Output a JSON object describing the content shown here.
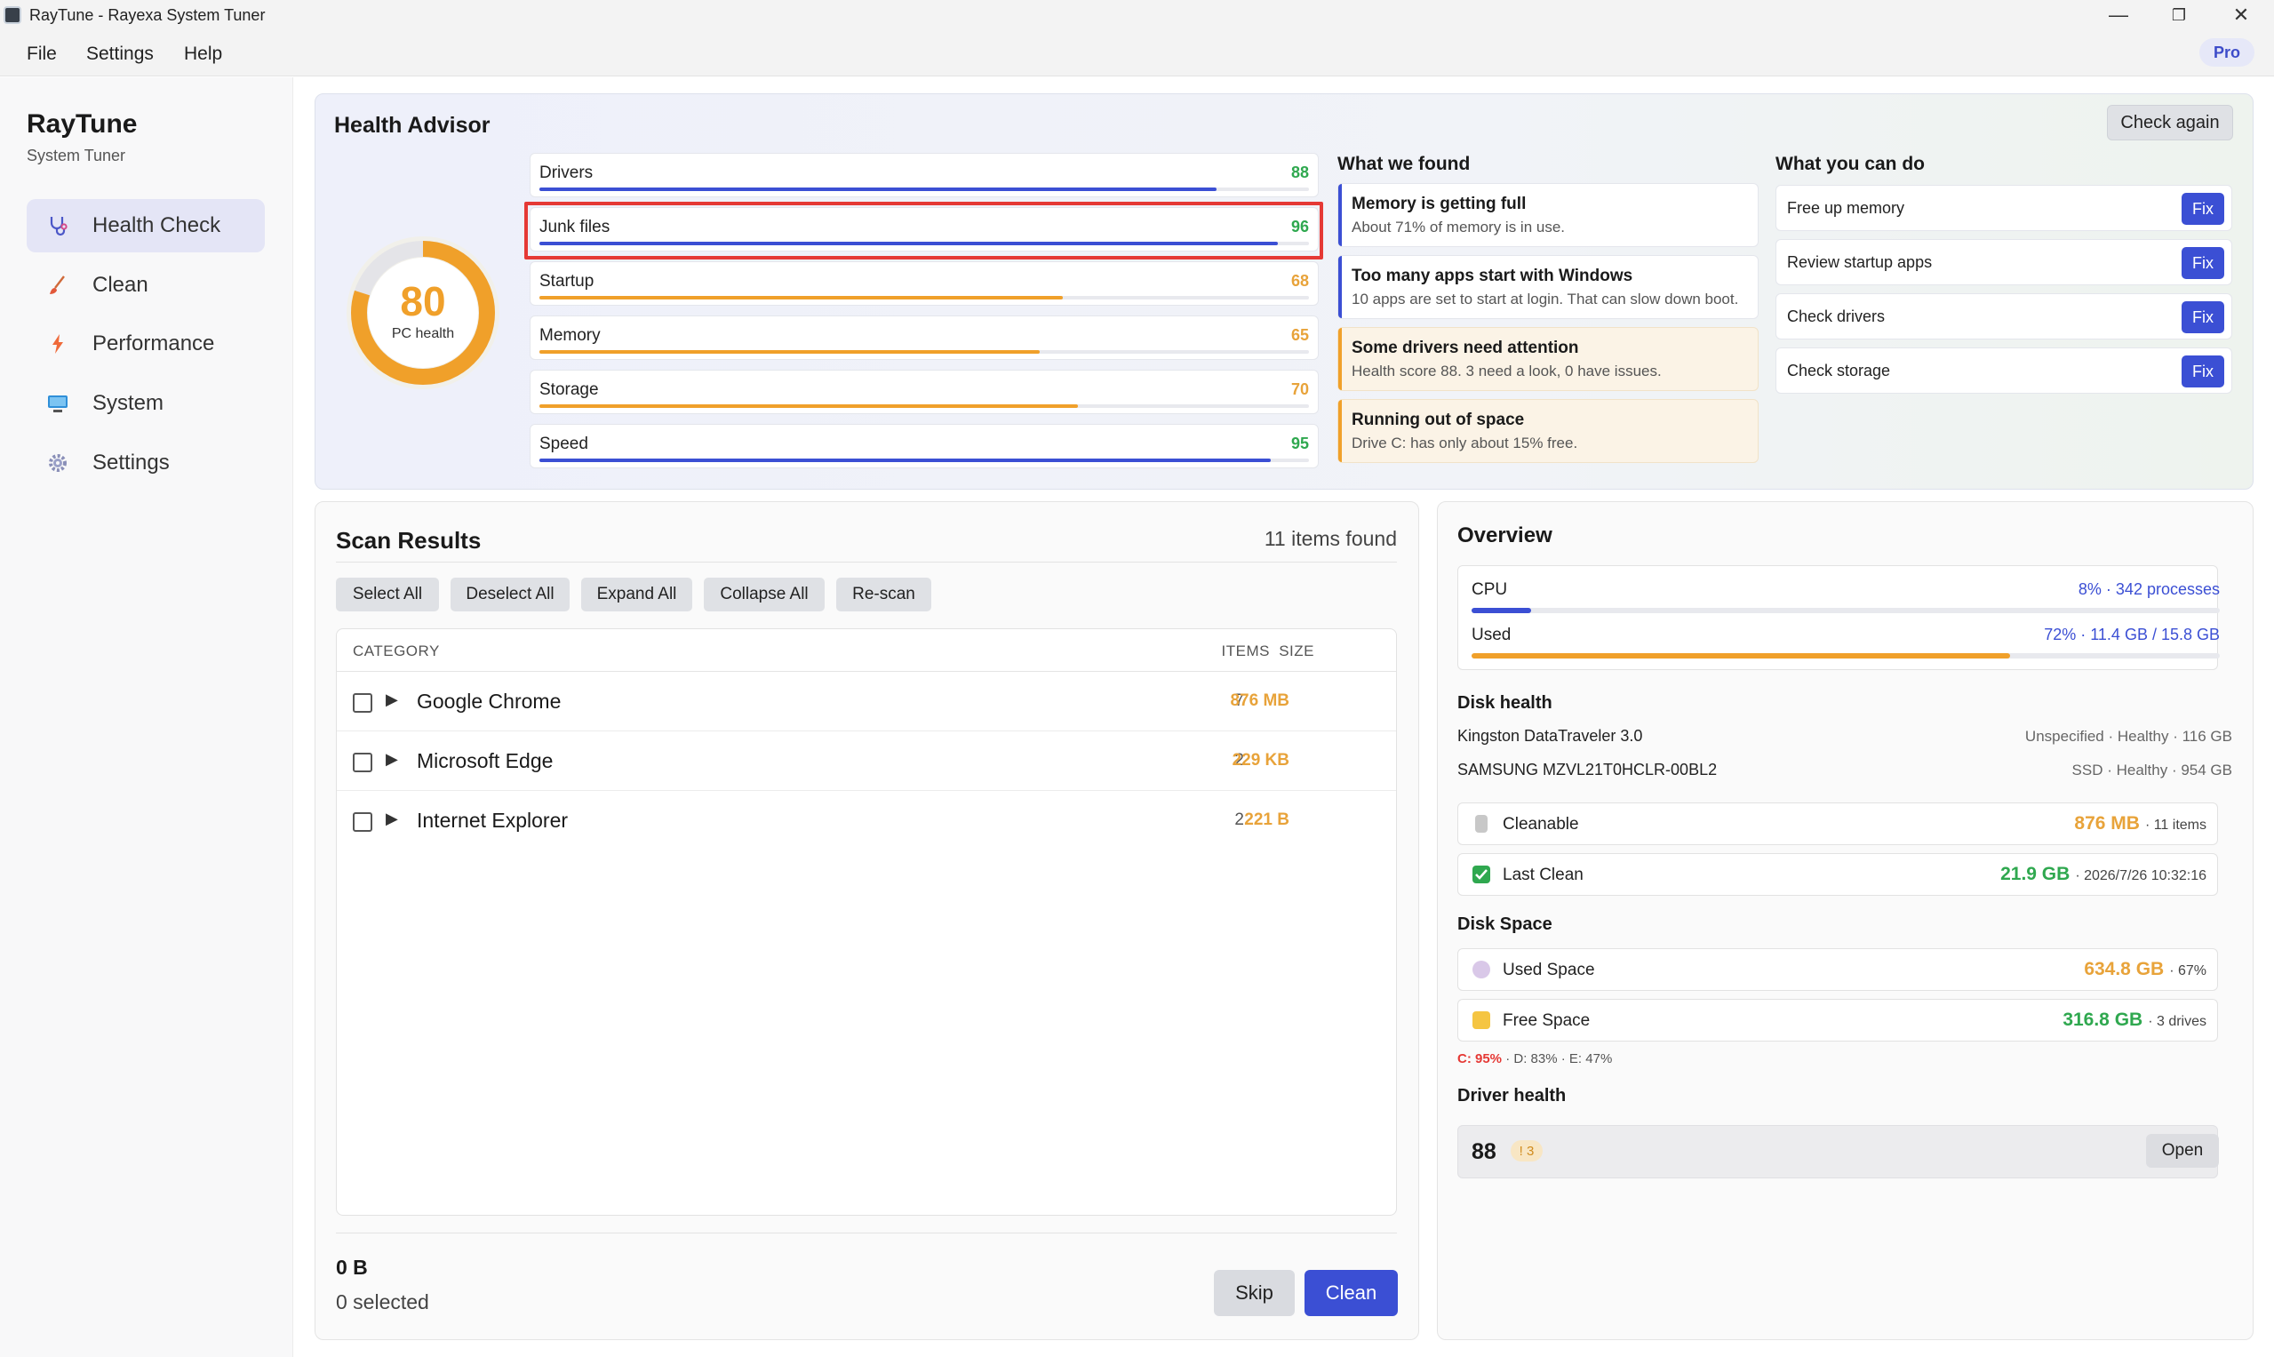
{
  "window": {
    "title": "RayTune - Rayexa System Tuner",
    "minimize": "—",
    "maximize": "❐",
    "close": "✕"
  },
  "menu": {
    "items": [
      "File",
      "Settings",
      "Help"
    ],
    "pro_badge": "Pro"
  },
  "brand": {
    "name": "RayTune",
    "subtitle": "System Tuner"
  },
  "sidebar": {
    "items": [
      {
        "label": "Health Check",
        "icon": "stethoscope-icon",
        "active": true
      },
      {
        "label": "Clean",
        "icon": "brush-icon"
      },
      {
        "label": "Performance",
        "icon": "lightning-icon"
      },
      {
        "label": "System",
        "icon": "monitor-icon"
      },
      {
        "label": "Settings",
        "icon": "gear-icon"
      }
    ]
  },
  "health": {
    "title": "Health Advisor",
    "check_again": "Check again",
    "score": "80",
    "score_label": "PC health",
    "score_fraction": 0.8,
    "metrics": [
      {
        "label": "Drivers",
        "value": "88",
        "fraction": 0.88,
        "color": "#3b4fd4",
        "value_color": "#2fa84f"
      },
      {
        "label": "Junk files",
        "value": "96",
        "fraction": 0.96,
        "color": "#3b4fd4",
        "value_color": "#2fa84f"
      },
      {
        "label": "Startup",
        "value": "68",
        "fraction": 0.68,
        "color": "#f0a02a",
        "value_color": "#e8a33a"
      },
      {
        "label": "Memory",
        "value": "65",
        "fraction": 0.65,
        "color": "#f0a02a",
        "value_color": "#e8a33a"
      },
      {
        "label": "Storage",
        "value": "70",
        "fraction": 0.7,
        "color": "#f0a02a",
        "value_color": "#e8a33a"
      },
      {
        "label": "Speed",
        "value": "95",
        "fraction": 0.95,
        "color": "#3b4fd4",
        "value_color": "#2fa84f"
      }
    ],
    "found_title": "What we found",
    "findings": [
      {
        "title": "Memory is getting full",
        "desc": "About 71% of memory is in use."
      },
      {
        "title": "Too many apps start with Windows",
        "desc": "10 apps are set to start at login. That can slow down boot."
      },
      {
        "title": "Some drivers need attention",
        "desc": "Health score 88. 3 need a look, 0 have issues."
      },
      {
        "title": "Running out of space",
        "desc": "Drive C: has only about 15% free."
      }
    ],
    "actions_title": "What you can do",
    "actions": [
      {
        "label": "Free up memory",
        "button": "Fix"
      },
      {
        "label": "Review startup apps",
        "button": "Fix"
      },
      {
        "label": "Check drivers",
        "button": "Fix"
      },
      {
        "label": "Check storage",
        "button": "Fix"
      }
    ]
  },
  "scan": {
    "title": "Scan Results",
    "count": "11 items found",
    "toolbar": [
      "Select All",
      "Deselect All",
      "Expand All",
      "Collapse All",
      "Re-scan"
    ],
    "columns": {
      "category": "CATEGORY",
      "items": "ITEMS",
      "size": "SIZE"
    },
    "rows": [
      {
        "name": "Google Chrome",
        "items": "7",
        "size": "876 MB"
      },
      {
        "name": "Microsoft Edge",
        "items": "2",
        "size": "229 KB"
      },
      {
        "name": "Internet Explorer",
        "items": "2",
        "size": "221 B"
      }
    ],
    "selected_size": "0 B",
    "selected_count": "0 selected",
    "skip": "Skip",
    "clean": "Clean"
  },
  "overview": {
    "title": "Overview",
    "cpu_label": "CPU",
    "cpu_value": "8% · 342 processes",
    "cpu_fraction": 0.08,
    "mem_label": "Used",
    "mem_value": "72% · 11.4 GB / 15.8 GB",
    "mem_fraction": 0.72,
    "disk_health_title": "Disk health",
    "disks": [
      {
        "name": "Kingston DataTraveler 3.0",
        "info": "Unspecified · Healthy · 116 GB"
      },
      {
        "name": "SAMSUNG MZVL21T0HCLR-00BL2",
        "info": "SSD · Healthy · 954 GB"
      }
    ],
    "cleanable": {
      "label": "Cleanable",
      "value": "876 MB",
      "extra": "· 11 items"
    },
    "last_clean": {
      "label": "Last Clean",
      "value": "21.9 GB",
      "extra": "· 2026/7/26 10:32:16"
    },
    "disk_space_title": "Disk Space",
    "used_space": {
      "label": "Used Space",
      "value": "634.8 GB",
      "extra": "· 67%"
    },
    "free_space": {
      "label": "Free Space",
      "value": "316.8 GB",
      "extra": "· 3 drives"
    },
    "drives": {
      "c": "C: 95%",
      "sep1": " · ",
      "d": "D: 83%",
      "sep2": " · ",
      "e": "E: 47%"
    },
    "driver_title": "Driver health",
    "driver_score": "88",
    "driver_badge": "! 3",
    "driver_open": "Open"
  },
  "colors": {
    "accent": "#3b4fd4",
    "warning": "#f0a02a",
    "good": "#2fa84f",
    "danger": "#e53935"
  }
}
